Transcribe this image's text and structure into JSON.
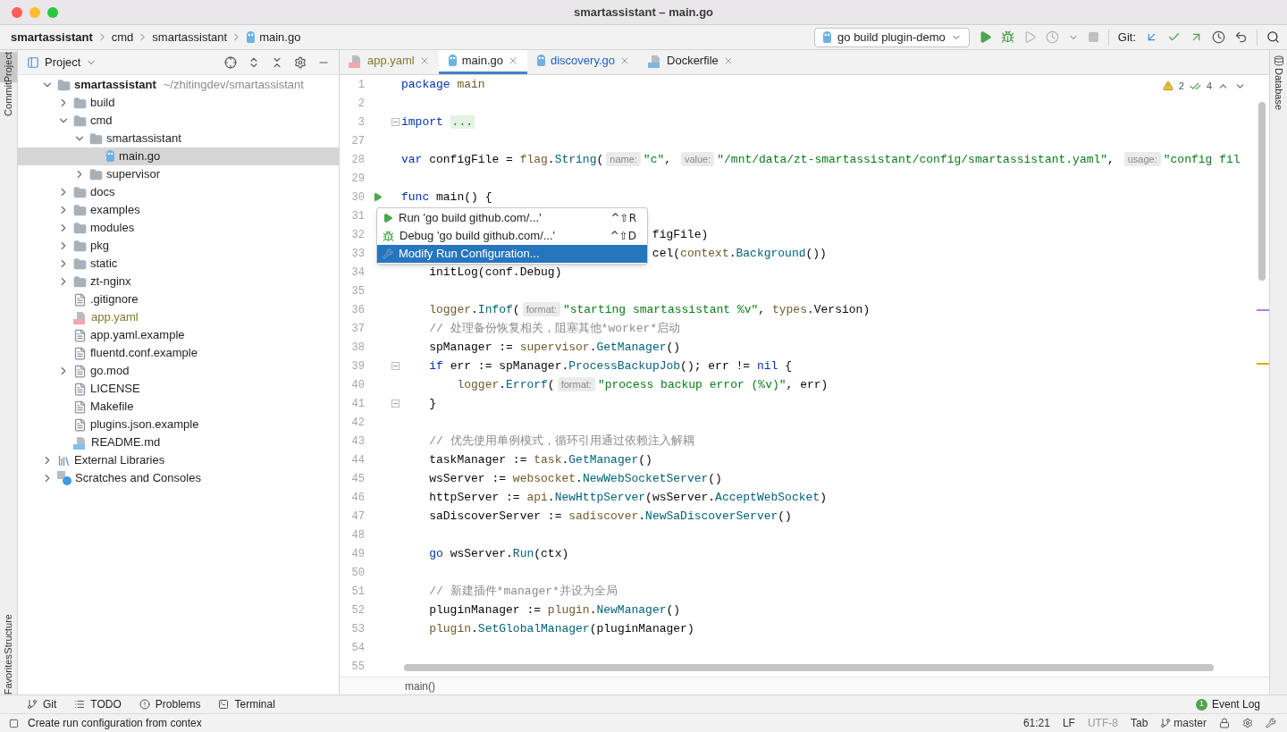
{
  "window": {
    "title": "smartassistant – main.go"
  },
  "breadcrumbs": [
    "smartassistant",
    "cmd",
    "smartassistant",
    "main.go"
  ],
  "run_config": {
    "label": "go build plugin-demo"
  },
  "git_label": "Git:",
  "left_tabs_top": [
    {
      "label": "Project",
      "selected": true
    },
    {
      "label": "Commit",
      "selected": false
    }
  ],
  "left_tabs_bottom": [
    {
      "label": "Structure",
      "selected": false
    },
    {
      "label": "Favorites",
      "selected": false
    }
  ],
  "project_panel": {
    "title": "Project"
  },
  "tree": [
    {
      "name": "smartassistant",
      "path": "~/zhitingdev/smartassistant",
      "kind": "project",
      "ignored": false,
      "selected": false,
      "expanded": true,
      "children": [
        {
          "name": "build",
          "kind": "folder",
          "ignored": false,
          "selected": false,
          "expanded": false
        },
        {
          "name": "cmd",
          "kind": "folder",
          "ignored": false,
          "selected": false,
          "expanded": true,
          "children": [
            {
              "name": "smartassistant",
              "kind": "folder",
              "ignored": false,
              "selected": false,
              "expanded": true,
              "children": [
                {
                  "name": "main.go",
                  "kind": "go",
                  "ignored": false,
                  "selected": true
                }
              ]
            },
            {
              "name": "supervisor",
              "kind": "folder",
              "ignored": false,
              "selected": false,
              "expanded": false
            }
          ]
        },
        {
          "name": "docs",
          "kind": "folder",
          "ignored": false,
          "selected": false,
          "expanded": false
        },
        {
          "name": "examples",
          "kind": "folder",
          "ignored": false,
          "selected": false,
          "expanded": false
        },
        {
          "name": "modules",
          "kind": "folder",
          "ignored": false,
          "selected": false,
          "expanded": false
        },
        {
          "name": "pkg",
          "kind": "folder",
          "ignored": false,
          "selected": false,
          "expanded": false
        },
        {
          "name": "static",
          "kind": "folder",
          "ignored": false,
          "selected": false,
          "expanded": false
        },
        {
          "name": "zt-nginx",
          "kind": "folder",
          "ignored": false,
          "selected": false,
          "expanded": false
        },
        {
          "name": ".gitignore",
          "kind": "ignore",
          "ignored": false,
          "selected": false
        },
        {
          "name": "app.yaml",
          "kind": "yaml",
          "ignored": true,
          "selected": false
        },
        {
          "name": "app.yaml.example",
          "kind": "text",
          "ignored": false,
          "selected": false
        },
        {
          "name": "fluentd.conf.example",
          "kind": "text",
          "ignored": false,
          "selected": false
        },
        {
          "name": "go.mod",
          "kind": "text",
          "ignored": false,
          "selected": false,
          "expanded": false
        },
        {
          "name": "LICENSE",
          "kind": "text",
          "ignored": false,
          "selected": false
        },
        {
          "name": "Makefile",
          "kind": "text",
          "ignored": false,
          "selected": false
        },
        {
          "name": "plugins.json.example",
          "kind": "text",
          "ignored": false,
          "selected": false
        },
        {
          "name": "README.md",
          "kind": "md",
          "ignored": false,
          "selected": false
        }
      ]
    },
    {
      "name": "External Libraries",
      "kind": "libraries",
      "ignored": false,
      "selected": false,
      "expanded": false
    },
    {
      "name": "Scratches and Consoles",
      "kind": "scratches",
      "ignored": false,
      "selected": false,
      "expanded": false
    }
  ],
  "editor_tabs": [
    {
      "label": "app.yaml",
      "kind": "yaml",
      "ignored": true,
      "modified": false,
      "selected": false
    },
    {
      "label": "main.go",
      "kind": "go",
      "ignored": false,
      "modified": false,
      "selected": true
    },
    {
      "label": "discovery.go",
      "kind": "go",
      "ignored": false,
      "modified": true,
      "selected": false
    },
    {
      "label": "Dockerfile",
      "kind": "docker",
      "ignored": false,
      "modified": false,
      "selected": false
    }
  ],
  "inspections": {
    "warnings": "2",
    "weak_warnings": "4"
  },
  "code": [
    {
      "number": "1",
      "tokens": [
        {
          "kind": "kw",
          "text": "package"
        },
        {
          "kind": "pkg",
          "text": " main"
        }
      ]
    },
    {
      "number": "2"
    },
    {
      "number": "3",
      "kind": "fold",
      "tokens": [
        {
          "kind": "kw",
          "text": "import "
        },
        {
          "kind": "folded",
          "text": "..."
        }
      ]
    },
    {
      "number": "27"
    },
    {
      "number": "28",
      "tokens": [
        {
          "kind": "kw",
          "text": "var"
        },
        {
          "kind": "plain",
          "text": " configFile = "
        },
        {
          "kind": "pkg",
          "text": "flag"
        },
        {
          "kind": "plain",
          "text": "."
        },
        {
          "kind": "fn",
          "text": "String"
        },
        {
          "kind": "plain",
          "text": "("
        },
        {
          "kind": "hint",
          "text": "name:"
        },
        {
          "kind": "str",
          "text": "\"c\""
        },
        {
          "kind": "plain",
          "text": ", "
        },
        {
          "kind": "hint",
          "text": "value:"
        },
        {
          "kind": "str",
          "text": "\"/mnt/data/zt-smartassistant/config/smartassistant.yaml\""
        },
        {
          "kind": "plain",
          "text": ", "
        },
        {
          "kind": "hint",
          "text": "usage:"
        },
        {
          "kind": "str",
          "text": "\"config fil"
        }
      ]
    },
    {
      "number": "29"
    },
    {
      "number": "30",
      "kind": "run",
      "tokens": [
        {
          "kind": "kw",
          "text": "func"
        },
        {
          "kind": "plain",
          "text": " main() {"
        }
      ]
    },
    {
      "number": "31"
    },
    {
      "number": "32",
      "tokens": [
        {
          "kind": "plain",
          "text": "                                    figFile)"
        }
      ]
    },
    {
      "number": "33",
      "tokens": [
        {
          "kind": "plain",
          "text": "                                    cel("
        },
        {
          "kind": "pkg",
          "text": "context"
        },
        {
          "kind": "plain",
          "text": "."
        },
        {
          "kind": "fn",
          "text": "Background"
        },
        {
          "kind": "plain",
          "text": "())"
        }
      ]
    },
    {
      "number": "34",
      "tokens": [
        {
          "kind": "plain",
          "text": "    initLog(conf.Debug)"
        }
      ]
    },
    {
      "number": "35"
    },
    {
      "number": "36",
      "tokens": [
        {
          "kind": "pkg",
          "text": "    logger"
        },
        {
          "kind": "plain",
          "text": "."
        },
        {
          "kind": "fn",
          "text": "Infof"
        },
        {
          "kind": "plain",
          "text": "("
        },
        {
          "kind": "hint",
          "text": "format:"
        },
        {
          "kind": "str",
          "text": "\"starting smartassistant %v\""
        },
        {
          "kind": "plain",
          "text": ", "
        },
        {
          "kind": "pkg",
          "text": "types"
        },
        {
          "kind": "plain",
          "text": ".Version)"
        }
      ]
    },
    {
      "number": "37",
      "tokens": [
        {
          "kind": "comment",
          "text": "    // 处理备份恢复相关，阻塞其他*worker*启动"
        }
      ]
    },
    {
      "number": "38",
      "tokens": [
        {
          "kind": "plain",
          "text": "    spManager := "
        },
        {
          "kind": "pkg",
          "text": "supervisor"
        },
        {
          "kind": "plain",
          "text": "."
        },
        {
          "kind": "fn",
          "text": "GetManager"
        },
        {
          "kind": "plain",
          "text": "()"
        }
      ]
    },
    {
      "number": "39",
      "kind": "fold",
      "tokens": [
        {
          "kind": "kw",
          "text": "    if"
        },
        {
          "kind": "plain",
          "text": " err := spManager."
        },
        {
          "kind": "fn",
          "text": "ProcessBackupJob"
        },
        {
          "kind": "plain",
          "text": "(); err != "
        },
        {
          "kind": "kw",
          "text": "nil"
        },
        {
          "kind": "plain",
          "text": " {"
        }
      ]
    },
    {
      "number": "40",
      "tokens": [
        {
          "kind": "pkg",
          "text": "        logger"
        },
        {
          "kind": "plain",
          "text": "."
        },
        {
          "kind": "fn",
          "text": "Errorf"
        },
        {
          "kind": "plain",
          "text": "("
        },
        {
          "kind": "hint",
          "text": "format:"
        },
        {
          "kind": "str",
          "text": "\"process backup error (%v)\""
        },
        {
          "kind": "plain",
          "text": ", err)"
        }
      ]
    },
    {
      "number": "41",
      "kind": "fold",
      "tokens": [
        {
          "kind": "plain",
          "text": "    }"
        }
      ]
    },
    {
      "number": "42"
    },
    {
      "number": "43",
      "tokens": [
        {
          "kind": "comment",
          "text": "    // 优先使用单例模式，循环引用通过依赖注入解耦"
        }
      ]
    },
    {
      "number": "44",
      "tokens": [
        {
          "kind": "plain",
          "text": "    taskManager := "
        },
        {
          "kind": "pkg",
          "text": "task"
        },
        {
          "kind": "plain",
          "text": "."
        },
        {
          "kind": "fn",
          "text": "GetManager"
        },
        {
          "kind": "plain",
          "text": "()"
        }
      ]
    },
    {
      "number": "45",
      "tokens": [
        {
          "kind": "plain",
          "text": "    wsServer := "
        },
        {
          "kind": "pkg",
          "text": "websocket"
        },
        {
          "kind": "plain",
          "text": "."
        },
        {
          "kind": "fn",
          "text": "NewWebSocketServer"
        },
        {
          "kind": "plain",
          "text": "()"
        }
      ]
    },
    {
      "number": "46",
      "tokens": [
        {
          "kind": "plain",
          "text": "    httpServer := "
        },
        {
          "kind": "pkg",
          "text": "api"
        },
        {
          "kind": "plain",
          "text": "."
        },
        {
          "kind": "fn",
          "text": "NewHttpServer"
        },
        {
          "kind": "plain",
          "text": "(wsServer."
        },
        {
          "kind": "fn",
          "text": "AcceptWebSocket"
        },
        {
          "kind": "plain",
          "text": ")"
        }
      ]
    },
    {
      "number": "47",
      "tokens": [
        {
          "kind": "plain",
          "text": "    saDiscoverServer := "
        },
        {
          "kind": "pkg",
          "text": "sadiscover"
        },
        {
          "kind": "plain",
          "text": "."
        },
        {
          "kind": "fn",
          "text": "NewSaDiscoverServer"
        },
        {
          "kind": "plain",
          "text": "()"
        }
      ]
    },
    {
      "number": "48"
    },
    {
      "number": "49",
      "tokens": [
        {
          "kind": "kw",
          "text": "    go"
        },
        {
          "kind": "plain",
          "text": " wsServer."
        },
        {
          "kind": "fn",
          "text": "Run"
        },
        {
          "kind": "plain",
          "text": "(ctx)"
        }
      ]
    },
    {
      "number": "50"
    },
    {
      "number": "51",
      "tokens": [
        {
          "kind": "comment",
          "text": "    // 新建插件*manager*并设为全局"
        }
      ]
    },
    {
      "number": "52",
      "tokens": [
        {
          "kind": "plain",
          "text": "    pluginManager := "
        },
        {
          "kind": "pkg",
          "text": "plugin"
        },
        {
          "kind": "plain",
          "text": "."
        },
        {
          "kind": "fn",
          "text": "NewManager"
        },
        {
          "kind": "plain",
          "text": "()"
        }
      ]
    },
    {
      "number": "53",
      "tokens": [
        {
          "kind": "pkg",
          "text": "    plugin"
        },
        {
          "kind": "plain",
          "text": "."
        },
        {
          "kind": "fn",
          "text": "SetGlobalManager"
        },
        {
          "kind": "plain",
          "text": "(pluginManager)"
        }
      ]
    },
    {
      "number": "54"
    },
    {
      "number": "55"
    }
  ],
  "popup": {
    "items": [
      {
        "kind": "run",
        "label": "Run 'go build github.com/...'",
        "shortcut": "^⇧R",
        "selected": false
      },
      {
        "kind": "debug",
        "label": "Debug 'go build github.com/...'",
        "shortcut": "^⇧D",
        "selected": false
      },
      {
        "kind": "edit",
        "label": "Modify Run Configuration...",
        "selected": true
      }
    ]
  },
  "editor_breadcrumb": "main()",
  "right_tabs": [
    {
      "label": "Database",
      "selected": false
    }
  ],
  "tool_windows": [
    {
      "kind": "git",
      "label": "Git"
    },
    {
      "kind": "todo",
      "label": "TODO"
    },
    {
      "kind": "problems",
      "label": "Problems"
    },
    {
      "kind": "terminal",
      "label": "Terminal"
    }
  ],
  "event_log": {
    "label": "Event Log",
    "badge": "1"
  },
  "status_bar": {
    "message": "Create run configuration from contex",
    "items": [
      {
        "kind": "text",
        "text": "61:21",
        "dimmed": false
      },
      {
        "kind": "text",
        "text": "LF",
        "dimmed": false
      },
      {
        "kind": "text",
        "text": "UTF-8",
        "dimmed": true
      },
      {
        "kind": "text",
        "text": "Tab",
        "dimmed": false
      },
      {
        "kind": "branch",
        "text": "master",
        "dimmed": false
      }
    ]
  }
}
